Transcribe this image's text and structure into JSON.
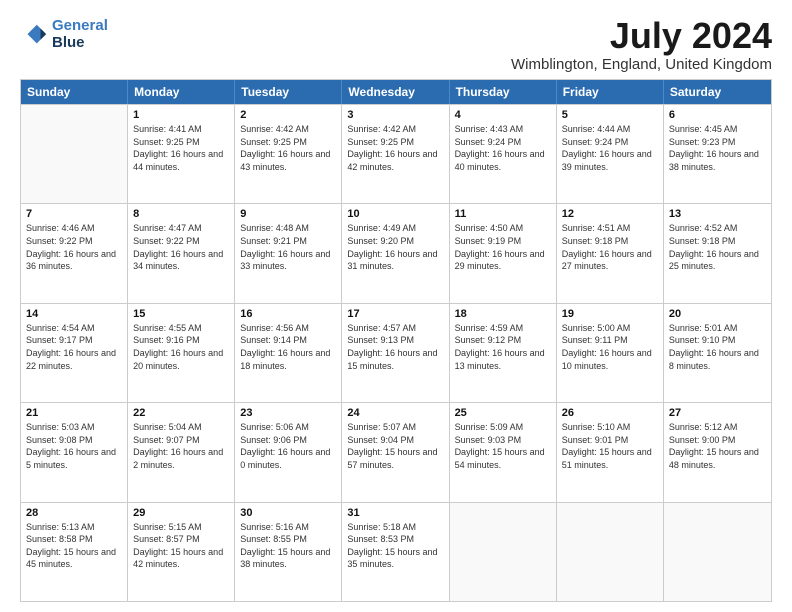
{
  "logo": {
    "line1": "General",
    "line2": "Blue"
  },
  "title": "July 2024",
  "subtitle": "Wimblington, England, United Kingdom",
  "header_days": [
    "Sunday",
    "Monday",
    "Tuesday",
    "Wednesday",
    "Thursday",
    "Friday",
    "Saturday"
  ],
  "weeks": [
    [
      {
        "day": "",
        "sunrise": "",
        "sunset": "",
        "daylight": ""
      },
      {
        "day": "1",
        "sunrise": "Sunrise: 4:41 AM",
        "sunset": "Sunset: 9:25 PM",
        "daylight": "Daylight: 16 hours and 44 minutes."
      },
      {
        "day": "2",
        "sunrise": "Sunrise: 4:42 AM",
        "sunset": "Sunset: 9:25 PM",
        "daylight": "Daylight: 16 hours and 43 minutes."
      },
      {
        "day": "3",
        "sunrise": "Sunrise: 4:42 AM",
        "sunset": "Sunset: 9:25 PM",
        "daylight": "Daylight: 16 hours and 42 minutes."
      },
      {
        "day": "4",
        "sunrise": "Sunrise: 4:43 AM",
        "sunset": "Sunset: 9:24 PM",
        "daylight": "Daylight: 16 hours and 40 minutes."
      },
      {
        "day": "5",
        "sunrise": "Sunrise: 4:44 AM",
        "sunset": "Sunset: 9:24 PM",
        "daylight": "Daylight: 16 hours and 39 minutes."
      },
      {
        "day": "6",
        "sunrise": "Sunrise: 4:45 AM",
        "sunset": "Sunset: 9:23 PM",
        "daylight": "Daylight: 16 hours and 38 minutes."
      }
    ],
    [
      {
        "day": "7",
        "sunrise": "Sunrise: 4:46 AM",
        "sunset": "Sunset: 9:22 PM",
        "daylight": "Daylight: 16 hours and 36 minutes."
      },
      {
        "day": "8",
        "sunrise": "Sunrise: 4:47 AM",
        "sunset": "Sunset: 9:22 PM",
        "daylight": "Daylight: 16 hours and 34 minutes."
      },
      {
        "day": "9",
        "sunrise": "Sunrise: 4:48 AM",
        "sunset": "Sunset: 9:21 PM",
        "daylight": "Daylight: 16 hours and 33 minutes."
      },
      {
        "day": "10",
        "sunrise": "Sunrise: 4:49 AM",
        "sunset": "Sunset: 9:20 PM",
        "daylight": "Daylight: 16 hours and 31 minutes."
      },
      {
        "day": "11",
        "sunrise": "Sunrise: 4:50 AM",
        "sunset": "Sunset: 9:19 PM",
        "daylight": "Daylight: 16 hours and 29 minutes."
      },
      {
        "day": "12",
        "sunrise": "Sunrise: 4:51 AM",
        "sunset": "Sunset: 9:18 PM",
        "daylight": "Daylight: 16 hours and 27 minutes."
      },
      {
        "day": "13",
        "sunrise": "Sunrise: 4:52 AM",
        "sunset": "Sunset: 9:18 PM",
        "daylight": "Daylight: 16 hours and 25 minutes."
      }
    ],
    [
      {
        "day": "14",
        "sunrise": "Sunrise: 4:54 AM",
        "sunset": "Sunset: 9:17 PM",
        "daylight": "Daylight: 16 hours and 22 minutes."
      },
      {
        "day": "15",
        "sunrise": "Sunrise: 4:55 AM",
        "sunset": "Sunset: 9:16 PM",
        "daylight": "Daylight: 16 hours and 20 minutes."
      },
      {
        "day": "16",
        "sunrise": "Sunrise: 4:56 AM",
        "sunset": "Sunset: 9:14 PM",
        "daylight": "Daylight: 16 hours and 18 minutes."
      },
      {
        "day": "17",
        "sunrise": "Sunrise: 4:57 AM",
        "sunset": "Sunset: 9:13 PM",
        "daylight": "Daylight: 16 hours and 15 minutes."
      },
      {
        "day": "18",
        "sunrise": "Sunrise: 4:59 AM",
        "sunset": "Sunset: 9:12 PM",
        "daylight": "Daylight: 16 hours and 13 minutes."
      },
      {
        "day": "19",
        "sunrise": "Sunrise: 5:00 AM",
        "sunset": "Sunset: 9:11 PM",
        "daylight": "Daylight: 16 hours and 10 minutes."
      },
      {
        "day": "20",
        "sunrise": "Sunrise: 5:01 AM",
        "sunset": "Sunset: 9:10 PM",
        "daylight": "Daylight: 16 hours and 8 minutes."
      }
    ],
    [
      {
        "day": "21",
        "sunrise": "Sunrise: 5:03 AM",
        "sunset": "Sunset: 9:08 PM",
        "daylight": "Daylight: 16 hours and 5 minutes."
      },
      {
        "day": "22",
        "sunrise": "Sunrise: 5:04 AM",
        "sunset": "Sunset: 9:07 PM",
        "daylight": "Daylight: 16 hours and 2 minutes."
      },
      {
        "day": "23",
        "sunrise": "Sunrise: 5:06 AM",
        "sunset": "Sunset: 9:06 PM",
        "daylight": "Daylight: 16 hours and 0 minutes."
      },
      {
        "day": "24",
        "sunrise": "Sunrise: 5:07 AM",
        "sunset": "Sunset: 9:04 PM",
        "daylight": "Daylight: 15 hours and 57 minutes."
      },
      {
        "day": "25",
        "sunrise": "Sunrise: 5:09 AM",
        "sunset": "Sunset: 9:03 PM",
        "daylight": "Daylight: 15 hours and 54 minutes."
      },
      {
        "day": "26",
        "sunrise": "Sunrise: 5:10 AM",
        "sunset": "Sunset: 9:01 PM",
        "daylight": "Daylight: 15 hours and 51 minutes."
      },
      {
        "day": "27",
        "sunrise": "Sunrise: 5:12 AM",
        "sunset": "Sunset: 9:00 PM",
        "daylight": "Daylight: 15 hours and 48 minutes."
      }
    ],
    [
      {
        "day": "28",
        "sunrise": "Sunrise: 5:13 AM",
        "sunset": "Sunset: 8:58 PM",
        "daylight": "Daylight: 15 hours and 45 minutes."
      },
      {
        "day": "29",
        "sunrise": "Sunrise: 5:15 AM",
        "sunset": "Sunset: 8:57 PM",
        "daylight": "Daylight: 15 hours and 42 minutes."
      },
      {
        "day": "30",
        "sunrise": "Sunrise: 5:16 AM",
        "sunset": "Sunset: 8:55 PM",
        "daylight": "Daylight: 15 hours and 38 minutes."
      },
      {
        "day": "31",
        "sunrise": "Sunrise: 5:18 AM",
        "sunset": "Sunset: 8:53 PM",
        "daylight": "Daylight: 15 hours and 35 minutes."
      },
      {
        "day": "",
        "sunrise": "",
        "sunset": "",
        "daylight": ""
      },
      {
        "day": "",
        "sunrise": "",
        "sunset": "",
        "daylight": ""
      },
      {
        "day": "",
        "sunrise": "",
        "sunset": "",
        "daylight": ""
      }
    ]
  ]
}
